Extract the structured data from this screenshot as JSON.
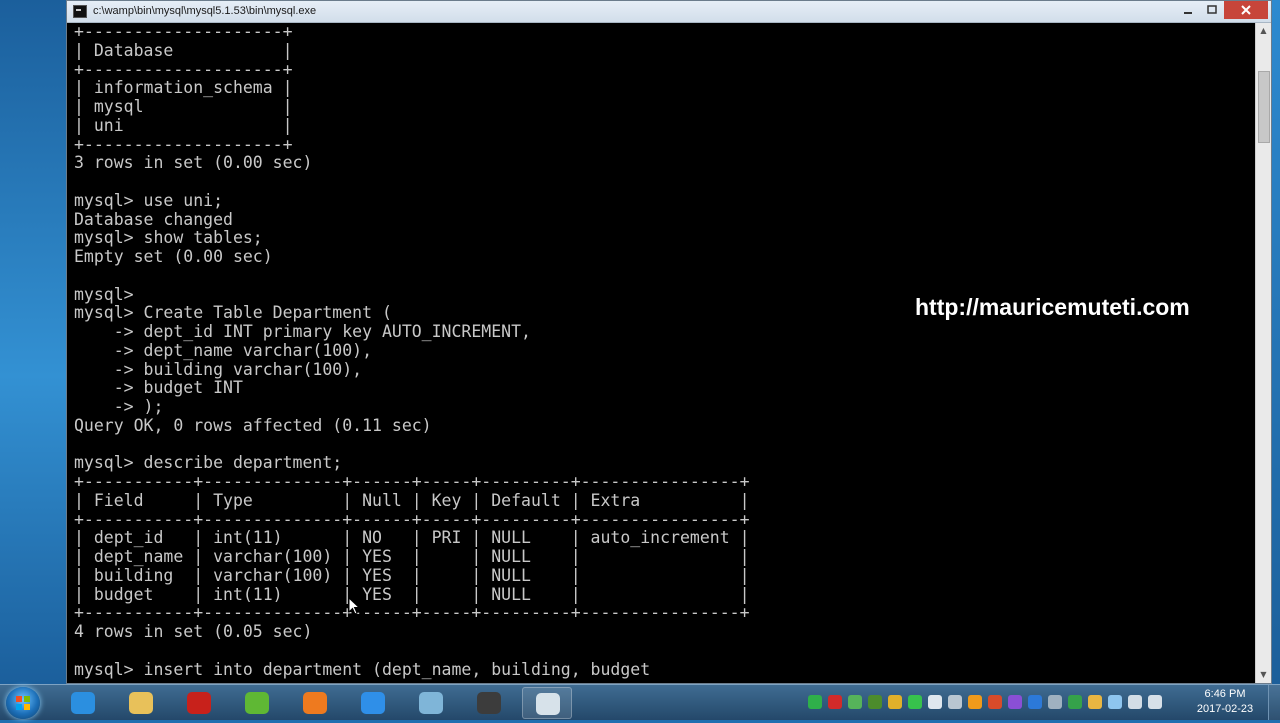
{
  "window": {
    "title": "c:\\wamp\\bin\\mysql\\mysql5.1.53\\bin\\mysql.exe",
    "minimize_icon": "minimize-icon",
    "maximize_icon": "maximize-icon",
    "close_icon": "close-icon"
  },
  "console": {
    "lines": [
      "+--------------------+",
      "| Database           |",
      "+--------------------+",
      "| information_schema |",
      "| mysql              |",
      "| uni                |",
      "+--------------------+",
      "3 rows in set (0.00 sec)",
      "",
      "mysql> use uni;",
      "Database changed",
      "mysql> show tables;",
      "Empty set (0.00 sec)",
      "",
      "mysql>",
      "mysql> Create Table Department (",
      "    -> dept_id INT primary key AUTO_INCREMENT,",
      "    -> dept_name varchar(100),",
      "    -> building varchar(100),",
      "    -> budget INT",
      "    -> );",
      "Query OK, 0 rows affected (0.11 sec)",
      "",
      "mysql> describe department;",
      "+-----------+--------------+------+-----+---------+----------------+",
      "| Field     | Type         | Null | Key | Default | Extra          |",
      "+-----------+--------------+------+-----+---------+----------------+",
      "| dept_id   | int(11)      | NO   | PRI | NULL    | auto_increment |",
      "| dept_name | varchar(100) | YES  |     | NULL    |                |",
      "| building  | varchar(100) | YES  |     | NULL    |                |",
      "| budget    | int(11)      | YES  |     | NULL    |                |",
      "+-----------+--------------+------+-----+---------+----------------+",
      "4 rows in set (0.05 sec)",
      "",
      "mysql> insert into department (dept_name, building, budget"
    ]
  },
  "watermark": "http://mauricemuteti.com",
  "taskbar": {
    "start_icon": "windows-start-icon",
    "buttons": [
      {
        "name": "internet-explorer-icon",
        "color": "#2b8fe0",
        "active": false
      },
      {
        "name": "file-explorer-icon",
        "color": "#e8c15a",
        "active": false
      },
      {
        "name": "app-red-icon",
        "color": "#c8211b",
        "active": false
      },
      {
        "name": "utorrent-icon",
        "color": "#5fb834",
        "active": false
      },
      {
        "name": "firefox-icon",
        "color": "#ee7a1f",
        "active": false
      },
      {
        "name": "media-player-icon",
        "color": "#2f8fe8",
        "active": false
      },
      {
        "name": "notepad-icon",
        "color": "#7fb5d8",
        "active": false
      },
      {
        "name": "app-tool-icon",
        "color": "#3c3c3c",
        "active": false
      },
      {
        "name": "console-window-icon",
        "color": "#d7e2ea",
        "active": true
      }
    ],
    "tray_icons": [
      {
        "name": "green-tray-icon",
        "color": "#2fb04a"
      },
      {
        "name": "record-tray-icon",
        "color": "#d22a2a"
      },
      {
        "name": "network-tray-icon",
        "color": "#56b35a"
      },
      {
        "name": "shield-tray-icon",
        "color": "#4c8c2c"
      },
      {
        "name": "chrome-tray-icon",
        "color": "#e1b02a"
      },
      {
        "name": "whatsapp-tray-icon",
        "color": "#37c24c"
      },
      {
        "name": "volume-tray-icon",
        "color": "#dfe7ee"
      },
      {
        "name": "gear-tray-icon",
        "color": "#b9c6d1"
      },
      {
        "name": "k-tray-icon",
        "color": "#f09a1b"
      },
      {
        "name": "s-tray-icon",
        "color": "#d84b2a"
      },
      {
        "name": "color-tray-icon",
        "color": "#8a4fd6"
      },
      {
        "name": "globe-tray-icon",
        "color": "#2c79d8"
      },
      {
        "name": "link-tray-icon",
        "color": "#9fb1c0"
      },
      {
        "name": "update-tray-icon",
        "color": "#35a24a"
      },
      {
        "name": "folder-tray-icon",
        "color": "#e9b642"
      },
      {
        "name": "wifi-tray-icon",
        "color": "#8ec5ef"
      },
      {
        "name": "flag-tray-icon",
        "color": "#d3dde6"
      },
      {
        "name": "signal-tray-icon",
        "color": "#d7e0e8"
      }
    ]
  },
  "clock": {
    "time": "6:46 PM",
    "date": "2017-02-23"
  }
}
